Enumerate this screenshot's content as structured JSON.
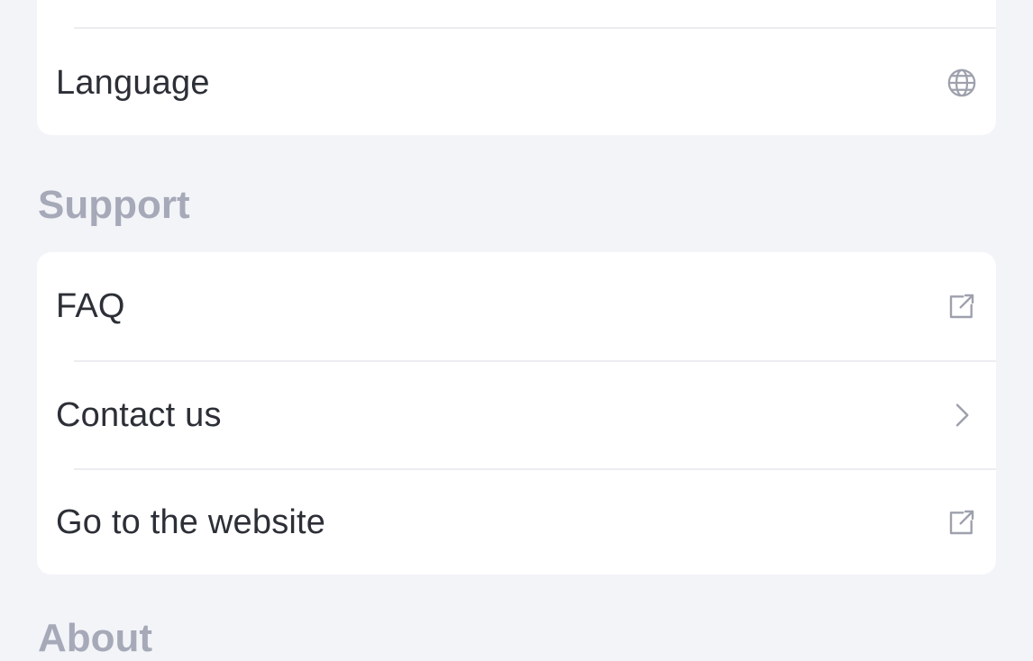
{
  "settings": {
    "language_label": "Language"
  },
  "support": {
    "title": "Support",
    "items": [
      {
        "label": "FAQ",
        "icon": "external-link-icon"
      },
      {
        "label": "Contact us",
        "icon": "chevron-right-icon"
      },
      {
        "label": "Go to the website",
        "icon": "external-link-icon"
      }
    ]
  },
  "about": {
    "title": "About"
  },
  "colors": {
    "background": "#f3f4f8",
    "card": "#ffffff",
    "text": "#2c2f36",
    "section_title": "#a6a9b8",
    "icon": "#9ea1ad",
    "divider": "#ececf1"
  }
}
